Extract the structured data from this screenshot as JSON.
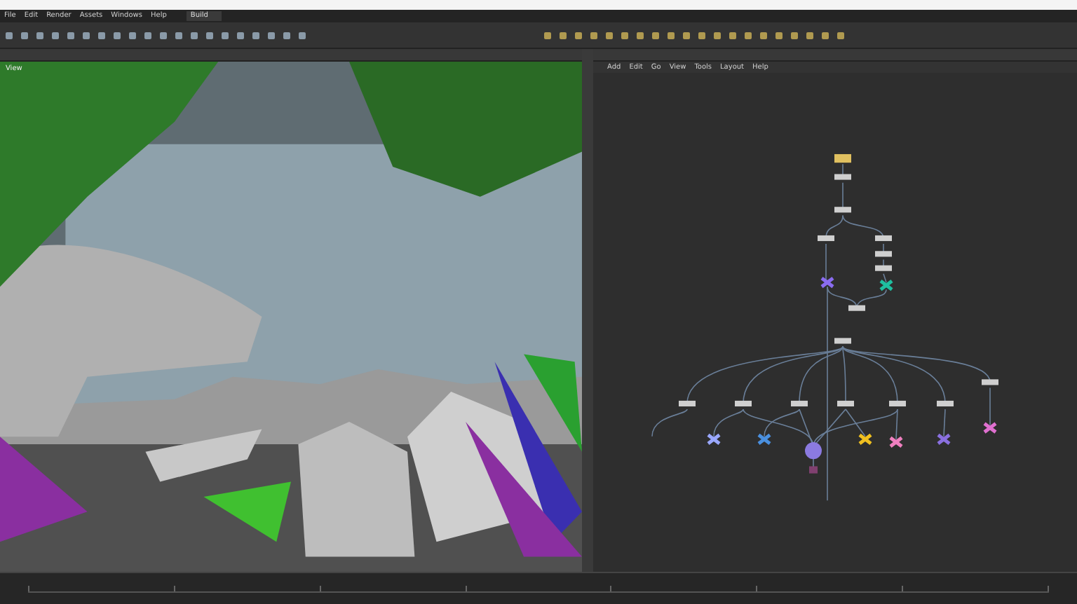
{
  "main_menu": [
    "File",
    "Edit",
    "Render",
    "Assets",
    "Windows",
    "Help"
  ],
  "desktop": {
    "label": "Build"
  },
  "viewport": {
    "label": "View"
  },
  "network_menu": [
    "Add",
    "Edit",
    "Go",
    "View",
    "Tools",
    "Layout",
    "Help"
  ]
}
